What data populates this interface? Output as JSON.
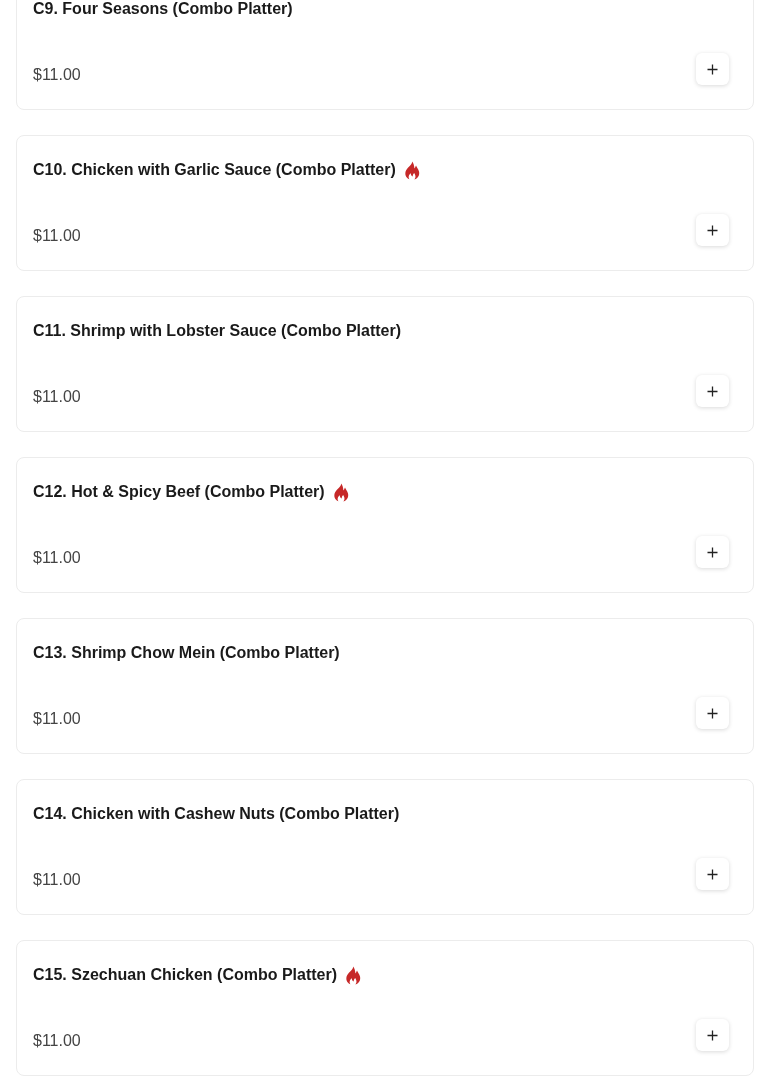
{
  "items": [
    {
      "name": "C9. Four Seasons (Combo Platter)",
      "spicy": false,
      "price": "$11.00"
    },
    {
      "name": "C10. Chicken with Garlic Sauce (Combo Platter)",
      "spicy": true,
      "price": "$11.00"
    },
    {
      "name": "C11. Shrimp with Lobster Sauce (Combo Platter)",
      "spicy": false,
      "price": "$11.00"
    },
    {
      "name": "C12. Hot & Spicy Beef (Combo Platter)",
      "spicy": true,
      "price": "$11.00"
    },
    {
      "name": "C13. Shrimp Chow Mein (Combo Platter)",
      "spicy": false,
      "price": "$11.00"
    },
    {
      "name": "C14. Chicken with Cashew Nuts (Combo Platter)",
      "spicy": false,
      "price": "$11.00"
    },
    {
      "name": "C15. Szechuan Chicken (Combo Platter)",
      "spicy": true,
      "price": "$11.00"
    }
  ]
}
